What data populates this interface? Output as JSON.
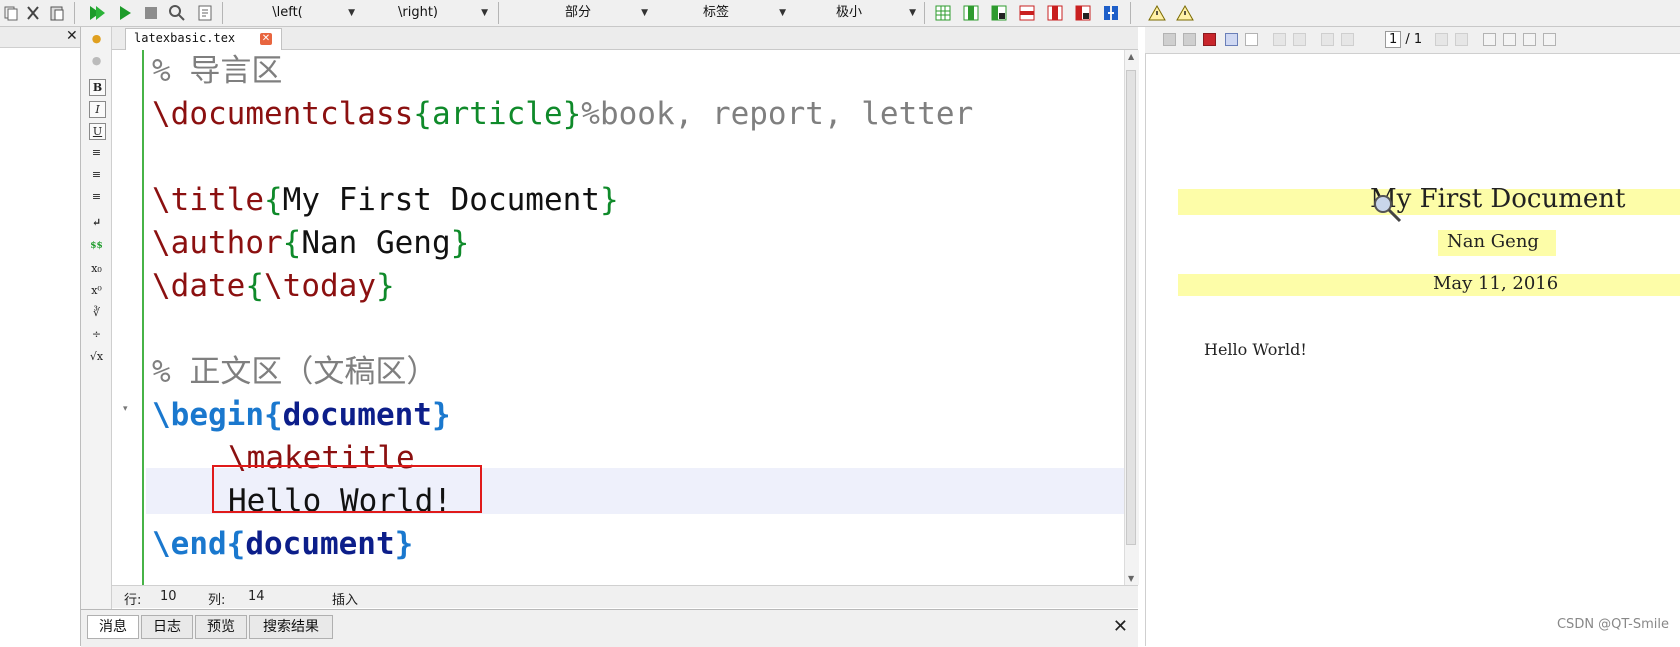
{
  "toolbar": {
    "left_delim": "\\left(",
    "right_delim": "\\right)",
    "section_level": "部分",
    "label_combo": "标签",
    "size_combo": "极小"
  },
  "editor": {
    "tab_name": "latexbasic.tex",
    "lines": {
      "l1": "% 导言区",
      "l2_cmd": "\\documentclass",
      "l2_open": "{",
      "l2_arg": "article",
      "l2_close": "}",
      "l2_comment": "%book, report, letter",
      "l3_cmd": "\\title",
      "l3_open": "{",
      "l3_arg": "My First Document",
      "l3_close": "}",
      "l4_cmd": "\\author",
      "l4_open": "{",
      "l4_arg": "Nan Geng",
      "l4_close": "}",
      "l5_cmd": "\\date",
      "l5_open": "{",
      "l5_arg": "\\today",
      "l5_close": "}",
      "l6": "% 正文区（文稿区）",
      "l7_cmd": "\\begin",
      "l7_open": "{",
      "l7_arg": "document",
      "l7_close": "}",
      "l8": "\\maketitle",
      "l9": "Hello World!",
      "l10_cmd": "\\end",
      "l10_open": "{",
      "l10_arg": "document",
      "l10_close": "}"
    }
  },
  "status": {
    "row_label": "行:",
    "row_value": "10",
    "col_label": "列:",
    "col_value": "14",
    "mode": "插入"
  },
  "messages": {
    "tabs": [
      "消息",
      "日志",
      "预览",
      "搜索结果"
    ]
  },
  "preview": {
    "page_current": "1",
    "page_total": "/ 1",
    "title": "My First Document",
    "author": "Nan Geng",
    "date": "May 11, 2016",
    "body": "Hello World!"
  },
  "watermark": "CSDN @QT-Smile",
  "colors": {
    "command": "#8b1010",
    "brace": "#0f8a2a",
    "comment": "#7f7f7f",
    "env_blue": "#1a78ce",
    "env_navy": "#0c1e8a",
    "highlight_box": "#e01a1a",
    "preview_highlight": "#fdfda8"
  },
  "symbols": [
    "B",
    "I",
    "U",
    "≡",
    "≡",
    "≡",
    "↵",
    "$$",
    "x₀",
    "x⁰",
    "∛",
    "÷",
    "√x"
  ]
}
